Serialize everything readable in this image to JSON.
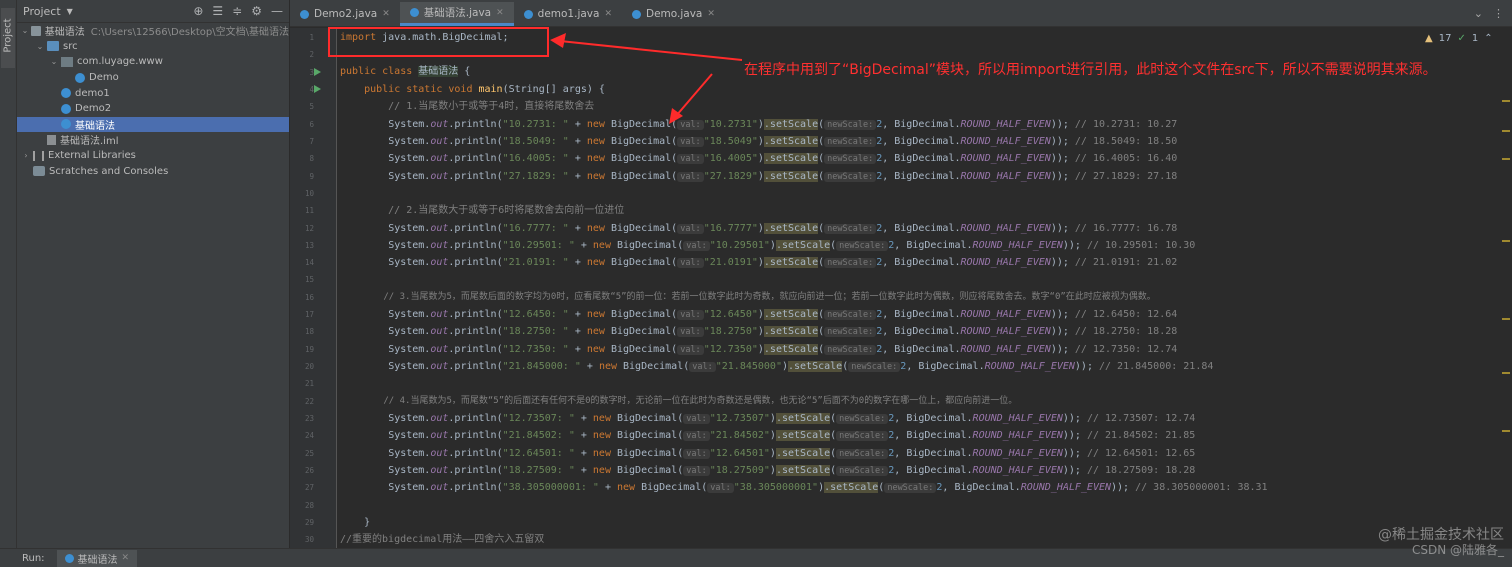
{
  "project_panel": {
    "title": "Project",
    "tree": [
      {
        "label": "基础语法",
        "path": "C:\\Users\\12566\\Desktop\\空文档\\基础语法",
        "depth": 0,
        "icon": "folder-icon",
        "expanded": true
      },
      {
        "label": "src",
        "depth": 1,
        "icon": "folder-icon",
        "expanded": true
      },
      {
        "label": "com.luyage.www",
        "depth": 2,
        "icon": "package-icon",
        "expanded": true
      },
      {
        "label": "Demo",
        "depth": 3,
        "icon": "class-icon"
      },
      {
        "label": "demo1",
        "depth": 2,
        "icon": "class-icon"
      },
      {
        "label": "Demo2",
        "depth": 2,
        "icon": "class-icon"
      },
      {
        "label": "基础语法",
        "depth": 2,
        "icon": "class-icon",
        "selected": true
      },
      {
        "label": "基础语法.iml",
        "depth": 1,
        "icon": "iml-file-icon"
      },
      {
        "label": "External Libraries",
        "depth": 0,
        "icon": "library-icon",
        "collapsed": true
      },
      {
        "label": "Scratches and Consoles",
        "depth": 0,
        "icon": "scratches-icon"
      }
    ]
  },
  "side_stripe": {
    "label": "Project"
  },
  "tabs": [
    {
      "label": "Demo2.java",
      "active": false
    },
    {
      "label": "基础语法.java",
      "active": true
    },
    {
      "label": "demo1.java",
      "active": false
    },
    {
      "label": "Demo.java",
      "active": false
    }
  ],
  "inspections": {
    "warnings": "17",
    "weak_warnings": "1"
  },
  "code": {
    "imp": "import",
    "imp_rest": " java.math.BigDecimal;",
    "cls_public": "public class ",
    "cls_name": "基础语法",
    "cls_rest": " {",
    "main_ws": "    ",
    "main_kw": "public static void ",
    "main_name": "main",
    "main_rest": "(String[] args) {",
    "close_brace": "    }",
    "c1": "        // 1.当尾数小于或等于4时，直接将尾数舍去",
    "c2": "        // 2.当尾数大于或等于6时将尾数舍去向前一位进位",
    "c3": "        // 3.当尾数为5，而尾数后面的数字均为0时，应看尾数“5”的前一位：若前一位数字此时为奇数，就应向前进一位；若前一位数字此时为偶数，则应将尾数舍去。数字“0”在此时应被视为偶数。",
    "c4": "        // 4.当尾数为5，而尾数“5”的后面还有任何不是0的数字时，无论前一位在此时为奇数还是偶数，也无论“5”后面不为0的数字在哪一位上，都应向前进一位。",
    "footer_comment": "//重要的bigdecimal用法——四舍六入五留双",
    "sys": "System.",
    "out": "out",
    "println": ".println(",
    "plus_new": " + ",
    "new_kw": "new",
    "bigdec_ctor": " BigDecimal(",
    "hint_val": "val:",
    "set_scale": ".setScale",
    "hint_new_scale": "newScale:",
    "scale_value": "2",
    "bigdec_mode_prefix": "BigDecimal.",
    "mode": "ROUND_HALF_EVEN",
    "call_end": ")); ",
    "open_paren": "(",
    "close_paren": ")",
    "comma": ", ",
    "line_numbers": [
      "1",
      "2",
      "3",
      "4",
      "5",
      "6",
      "7",
      "8",
      "9",
      "10",
      "11",
      "12",
      "13",
      "14",
      "15",
      "16",
      "17",
      "18",
      "19",
      "20",
      "21",
      "22",
      "23",
      "24",
      "25",
      "26",
      "27",
      "28",
      "29",
      "30"
    ],
    "println_rows": [
      {
        "line": 6,
        "label": "\"10.2731: \"",
        "arg": "\"10.2731\"",
        "result": "// 10.2731: 10.27"
      },
      {
        "line": 7,
        "label": "\"18.5049: \"",
        "arg": "\"18.5049\"",
        "result": "// 18.5049: 18.50"
      },
      {
        "line": 8,
        "label": "\"16.4005: \"",
        "arg": "\"16.4005\"",
        "result": "// 16.4005: 16.40"
      },
      {
        "line": 9,
        "label": "\"27.1829: \"",
        "arg": "\"27.1829\"",
        "result": "// 27.1829: 27.18"
      },
      {
        "line": 12,
        "label": "\"16.7777: \"",
        "arg": "\"16.7777\"",
        "result": "// 16.7777: 16.78"
      },
      {
        "line": 13,
        "label": "\"10.29501: \"",
        "arg": "\"10.29501\"",
        "result": "// 10.29501: 10.30"
      },
      {
        "line": 14,
        "label": "\"21.0191: \"",
        "arg": "\"21.0191\"",
        "result": "// 21.0191: 21.02"
      },
      {
        "line": 17,
        "label": "\"12.6450: \"",
        "arg": "\"12.6450\"",
        "result": "// 12.6450: 12.64"
      },
      {
        "line": 18,
        "label": "\"18.2750: \"",
        "arg": "\"18.2750\"",
        "result": "// 18.2750: 18.28"
      },
      {
        "line": 19,
        "label": "\"12.7350: \"",
        "arg": "\"12.7350\"",
        "result": "// 12.7350: 12.74"
      },
      {
        "line": 20,
        "label": "\"21.845000: \"",
        "arg": "\"21.845000\"",
        "result": "// 21.845000: 21.84"
      },
      {
        "line": 23,
        "label": "\"12.73507: \"",
        "arg": "\"12.73507\"",
        "result": "// 12.73507: 12.74"
      },
      {
        "line": 24,
        "label": "\"21.84502: \"",
        "arg": "\"21.84502\"",
        "result": "// 21.84502: 21.85"
      },
      {
        "line": 25,
        "label": "\"12.64501: \"",
        "arg": "\"12.64501\"",
        "result": "// 12.64501: 12.65"
      },
      {
        "line": 26,
        "label": "\"18.27509: \"",
        "arg": "\"18.27509\"",
        "result": "// 18.27509: 18.28"
      },
      {
        "line": 27,
        "label": "\"38.305000001: \"",
        "arg": "\"38.305000001\"",
        "result": "// 38.305000001: 38.31"
      }
    ]
  },
  "annotation": "在程序中用到了“BigDecimal”模块，所以用import进行引用，此时这个文件在src下，所以不需要说明其来源。",
  "statusbar": {
    "run_label": "Run:",
    "run_config": "基础语法"
  },
  "watermark": {
    "line1": "@稀土掘金技术社区",
    "line2": "CSDN @陆雅各_"
  },
  "colors": {
    "keyword": "#cc7832",
    "string": "#6a8759",
    "comment": "#808080",
    "annotation": "#ff3030",
    "selection": "#4b6eaf"
  }
}
